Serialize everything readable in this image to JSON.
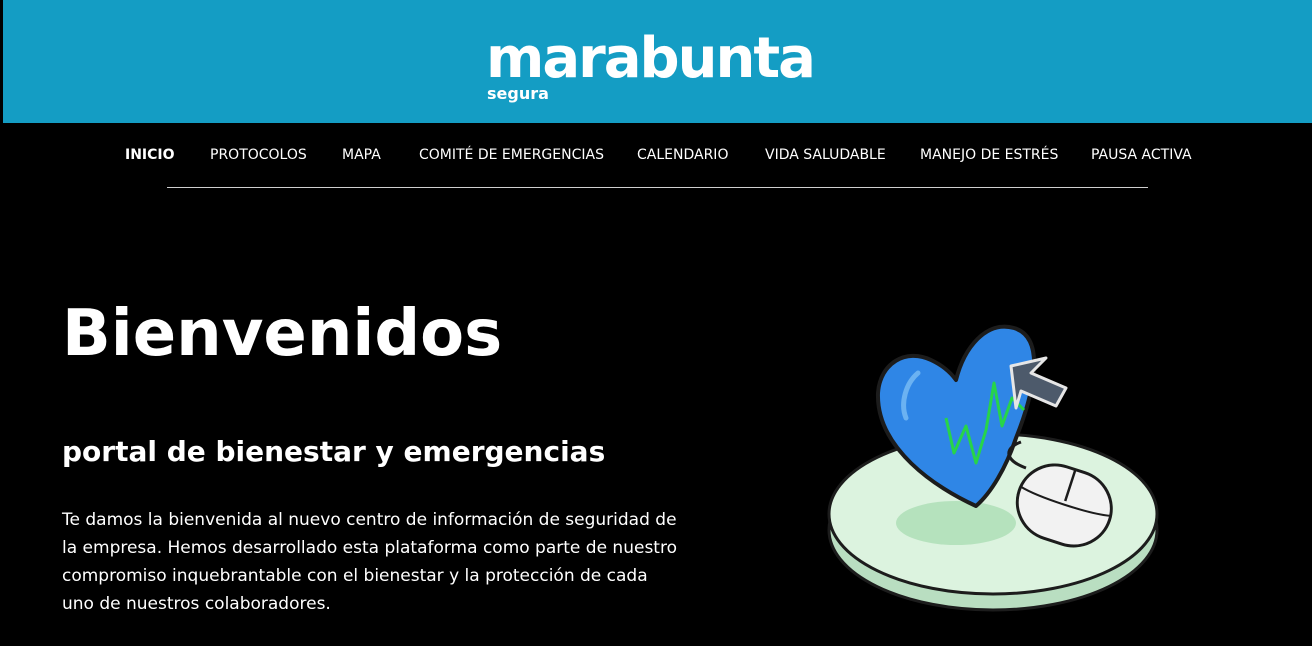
{
  "brand": {
    "name": "marabunta",
    "tagline": "segura",
    "header_color": "#149dc4"
  },
  "nav": {
    "items": [
      {
        "label": "INICIO",
        "active": true
      },
      {
        "label": "PROTOCOLOS",
        "active": false
      },
      {
        "label": "MAPA",
        "active": false
      },
      {
        "label": "COMITÉ DE EMERGENCIAS",
        "active": false
      },
      {
        "label": "CALENDARIO",
        "active": false
      },
      {
        "label": "VIDA SALUDABLE",
        "active": false
      },
      {
        "label": "MANEJO DE ESTRÉS",
        "active": false
      },
      {
        "label": "PAUSA ACTIVA",
        "active": false
      }
    ]
  },
  "hero": {
    "title": "Bienvenidos",
    "subtitle": "portal de bienestar y emergencias",
    "body": "Te damos la bienvenida al nuevo centro de información de seguridad de la empresa. Hemos desarrollado esta plataforma como parte de nuestro compromiso inquebrantable con el bienestar y la protección de cada uno de nuestros colaboradores.",
    "illustration_icon": "heart-pulse-mouse-icon"
  },
  "colors": {
    "background": "#000000",
    "heart": "#2f86e6",
    "pulse": "#27d44a",
    "platform": "#d9f2de"
  }
}
